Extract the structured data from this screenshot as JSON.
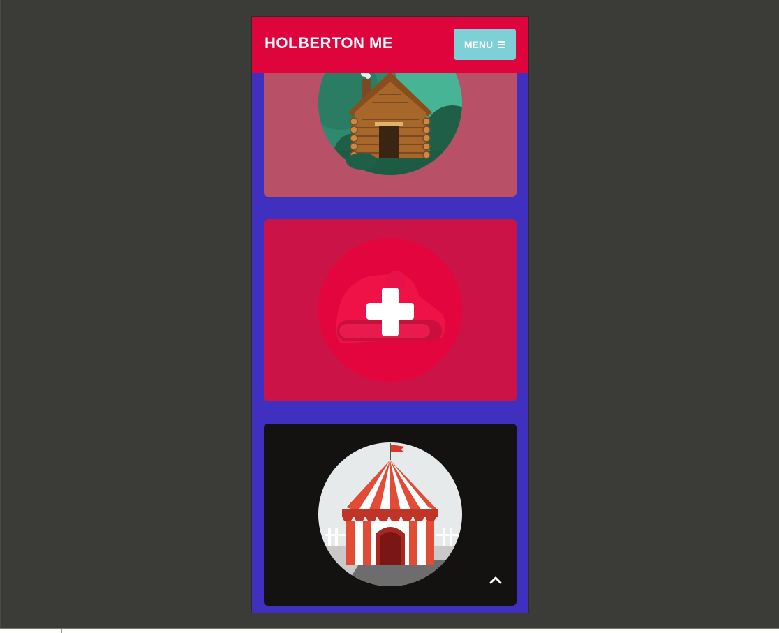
{
  "header": {
    "brand": "HOLBERTON ME",
    "menu_label": "MENU",
    "menu_icon": "hamburger-icon"
  },
  "cards": [
    {
      "name": "cabin",
      "icon": "cabin-icon",
      "background": "#b85067"
    },
    {
      "name": "plus",
      "icon": "plus-icon",
      "background": "#cc1347"
    },
    {
      "name": "circus-tent",
      "icon": "circus-tent-icon",
      "background": "#141111"
    }
  ],
  "scroll_top": {
    "icon": "chevron-up-icon"
  },
  "colors": {
    "header": "#e0043d",
    "page": "#4030c0",
    "menu_button": "#7dd0d6",
    "desktop": "#3b3b37"
  }
}
